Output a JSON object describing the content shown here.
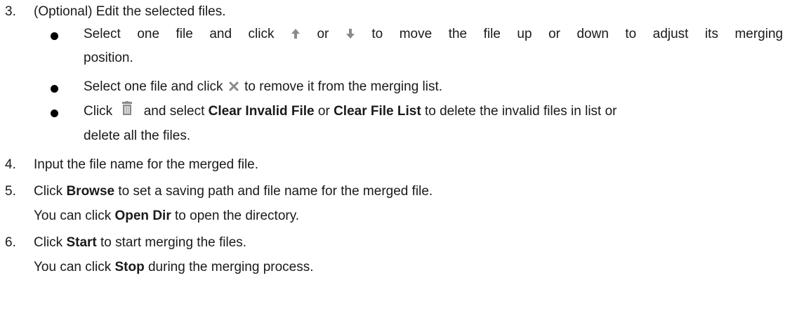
{
  "steps": [
    {
      "num": "3.",
      "text": "(Optional) Edit the selected files."
    },
    {
      "num": "4.",
      "text": "Input the file name for the merged file."
    },
    {
      "num": "5.",
      "parts": [
        "Click ",
        "Browse",
        " to set a saving path and file name for the merged file."
      ],
      "sub": [
        "You can click ",
        "Open Dir",
        " to open the directory."
      ]
    },
    {
      "num": "6.",
      "parts": [
        "Click ",
        "Start",
        " to start merging the files."
      ],
      "sub": [
        "You can click ",
        "Stop",
        " during the merging process."
      ]
    }
  ],
  "bullets": [
    {
      "line1": [
        "Select",
        "one",
        "file",
        "and",
        "click",
        "or",
        "to",
        "move",
        "the",
        "file",
        "up",
        "or",
        "down",
        "to",
        "adjust",
        "its",
        "merging"
      ],
      "line2": "position.",
      "icons": [
        "arrow-up-icon",
        "arrow-down-icon"
      ]
    },
    {
      "parts": [
        "Select one file and click ",
        " to remove it from the merging list."
      ],
      "icons": [
        "close-icon"
      ]
    },
    {
      "parts": [
        "Click ",
        " and select ",
        "Clear Invalid File",
        " or ",
        "Clear File List",
        " to delete the invalid files in list or"
      ],
      "line2": "delete all the files.",
      "icons": [
        "trash-icon"
      ]
    }
  ],
  "colors": {
    "text": "#1a1a1a",
    "icon_gray": "#8a8a8a",
    "bullet": "#000000"
  }
}
